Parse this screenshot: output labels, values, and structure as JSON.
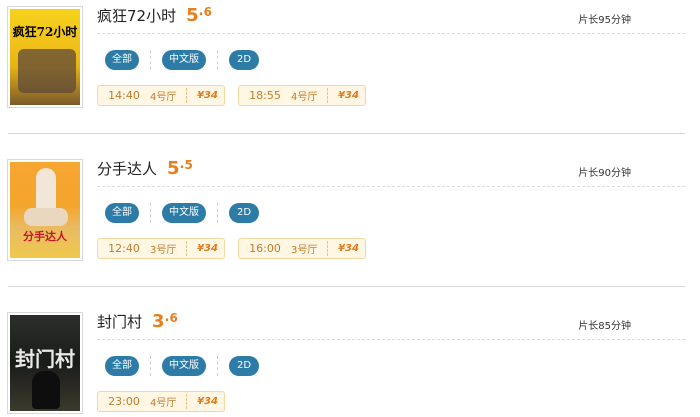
{
  "movies": [
    {
      "title": "疯狂72小时",
      "poster_text": "疯狂72小时",
      "rating_int": "5",
      "rating_dot": ".",
      "rating_dec": "6",
      "duration": "片长95分钟",
      "filters": [
        "全部",
        "中文版",
        "2D"
      ],
      "showtimes": [
        {
          "time": "14:40",
          "hall": "4号厅",
          "price": "¥34"
        },
        {
          "time": "18:55",
          "hall": "4号厅",
          "price": "¥34"
        }
      ]
    },
    {
      "title": "分手达人",
      "poster_text": "分手达人",
      "rating_int": "5",
      "rating_dot": ".",
      "rating_dec": "5",
      "duration": "片长90分钟",
      "filters": [
        "全部",
        "中文版",
        "2D"
      ],
      "showtimes": [
        {
          "time": "12:40",
          "hall": "3号厅",
          "price": "¥34"
        },
        {
          "time": "16:00",
          "hall": "3号厅",
          "price": "¥34"
        }
      ]
    },
    {
      "title": "封门村",
      "poster_text": "封门村",
      "rating_int": "3",
      "rating_dot": ".",
      "rating_dec": "6",
      "duration": "片长85分钟",
      "filters": [
        "全部",
        "中文版",
        "2D"
      ],
      "showtimes": [
        {
          "time": "23:00",
          "hall": "4号厅",
          "price": "¥34"
        }
      ]
    }
  ],
  "colors": {
    "rating": "#e67f1e",
    "pill_bg": "#2d7ca7",
    "slot_bg": "#fff7e4",
    "slot_border": "#f2d7a0",
    "price": "#e07a1c"
  }
}
